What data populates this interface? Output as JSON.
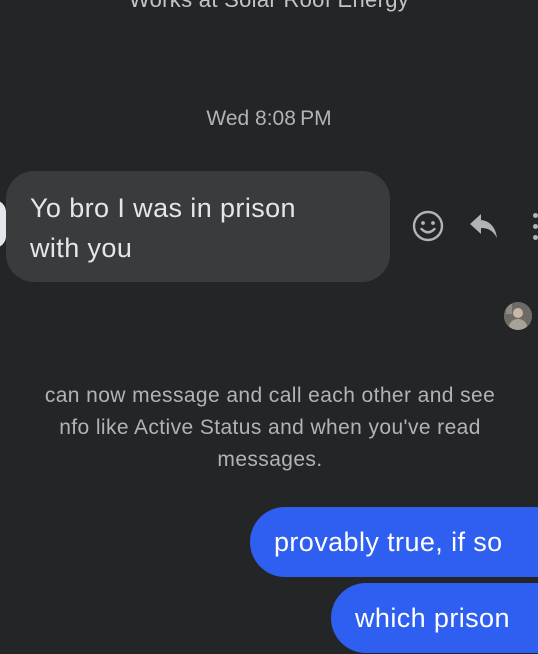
{
  "profile": {
    "works_at": "Works at Solar Roof Energy"
  },
  "thread": {
    "timestamp": "Wed 8:08 PM",
    "incoming_message": {
      "line1": "Yo bro I was in prison",
      "line2": "with you"
    },
    "actions": {
      "react_icon": "smiley-icon",
      "reply_icon": "reply-arrow-icon",
      "more_icon": "more-vertical-icon"
    },
    "notice": {
      "line1": "can now message and call each other and see",
      "line2": "nfo like Active Status and when you've read",
      "line3": "messages."
    },
    "outgoing_messages": [
      {
        "text": "provably true, if so"
      },
      {
        "text": "which prison"
      }
    ]
  },
  "colors": {
    "background": "#242526",
    "incoming_bubble": "#3a3b3c",
    "outgoing_bubble": "#2e5ff0",
    "secondary_text": "#b0b3b8"
  }
}
